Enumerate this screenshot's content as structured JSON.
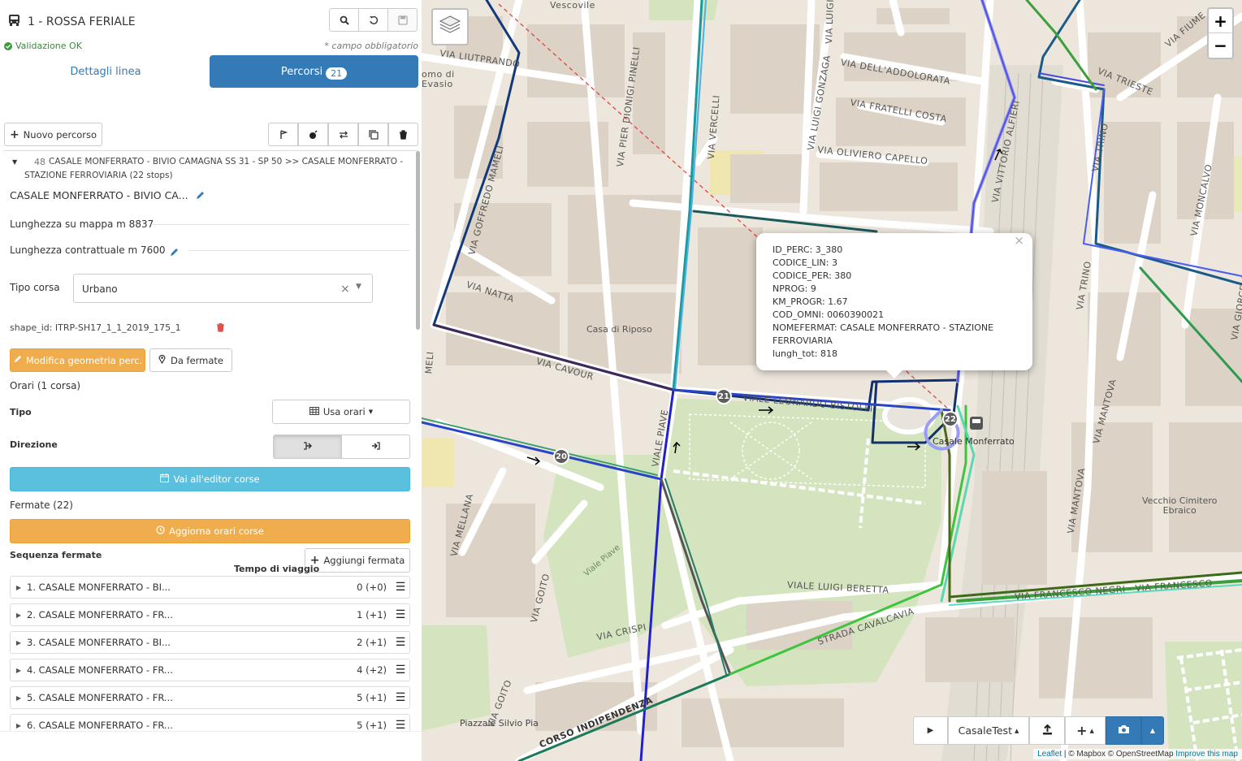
{
  "header": {
    "line_title": "1 - ROSSA FERIALE",
    "validation": "Validazione OK",
    "required_note": "* campo obbligatorio"
  },
  "tabs": {
    "details": "Dettagli linea",
    "routes": "Percorsi",
    "routes_count": "21"
  },
  "toolbar": {
    "new_route": "Nuovo percorso"
  },
  "route": {
    "id": "48",
    "description_line1": "CASALE MONFERRATO - BIVIO CAMAGNA SS 31 - SP 50 >> CASALE MONFERRATO -",
    "description_line2": "STAZIONE FERROVIARIA (22 stops)",
    "name": "CASALE MONFERRATO - BIVIO CA...",
    "map_length": "Lunghezza su mappa m 8837",
    "contract_length": "Lunghezza contrattuale m 7600",
    "trip_type_label": "Tipo corsa",
    "trip_type_value": "Urbano",
    "shape_id": "shape_id: ITRP-SH17_1_1_2019_175_1",
    "edit_geometry": "Modifica geometria perc.",
    "from_stops": "Da fermate",
    "schedules": "Orari (1 corsa)",
    "type_label": "Tipo",
    "use_schedules": "Usa orari",
    "direction_label": "Direzione",
    "editor_button": "Vai all'editor corse",
    "stops_header": "Fermate (22)",
    "update_button": "Aggiorna orari corse",
    "sequence_label": "Sequenza fermate",
    "add_stop": "Aggiungi fermata",
    "travel_time": "Tempo di viaggio"
  },
  "stops": [
    {
      "name": "1. CASALE MONFERRATO - BI...",
      "time": "0 (+0)"
    },
    {
      "name": "2. CASALE MONFERRATO - FR...",
      "time": "1 (+1)"
    },
    {
      "name": "3. CASALE MONFERRATO - BI...",
      "time": "2 (+1)"
    },
    {
      "name": "4. CASALE MONFERRATO - FR...",
      "time": "4 (+2)"
    },
    {
      "name": "5. CASALE MONFERRATO - FR...",
      "time": "5 (+1)"
    },
    {
      "name": "6. CASALE MONFERRATO - FR...",
      "time": "5 (+1)"
    }
  ],
  "popup": {
    "lines": [
      "ID_PERC: 3_380",
      "CODICE_LIN: 3",
      "CODICE_PER: 380",
      "NPROG: 9",
      "KM_PROGR: 1.67",
      "COD_OMNI: 0060390021",
      "NOMEFERMAT: CASALE MONFERRATO - STAZIONE",
      "FERROVIARIA",
      "lungh_tot: 818"
    ]
  },
  "map": {
    "zoom_in": "+",
    "zoom_out": "−",
    "layer_name": "CasaleTest",
    "attribution_leaflet": "Leaflet",
    "attribution_rest": " | © Mapbox © OpenStreetMap ",
    "attribution_improve": "Improve this map",
    "markers": [
      "21",
      "20",
      "22"
    ],
    "labels": {
      "vescovile": "Vescovile",
      "liutprando": "VIA LIUTPRANDO",
      "evasio": "omo di\nEvasio",
      "pinelli": "VIA PIER DIONIGI PINELLI",
      "vercelli": "VIA VERCELLI",
      "luigi": "VIA LUIGI",
      "gonzaga": "VIA LUIGI GONZAGA",
      "addolorata": "VIA DELL'ADDOLORATA",
      "fratelli": "VIA FRATELLI COSTA",
      "capello": "VIA OLIVIERO CAPELLO",
      "alfieri": "VIA VITTORIO ALFIERI",
      "trieste": "VIA TRIESTE",
      "fiume": "VIA FIUME",
      "trino": "VIA TRINO",
      "trino2": "VIA TRINO",
      "moncalvo": "VIA MONCALVO",
      "giorcelli": "VIA GIORCELLI",
      "mameli": "VIA GOFFREDO MAMELI",
      "natta": "VIA NATTA",
      "riposo": "Casa di Riposo",
      "cavour": "VIA CAVOUR",
      "bistolfi": "VIALE LEONARDO BISTOLFI",
      "piave": "VIALE PIAVE",
      "casale": "Casale Monferrato",
      "mellana": "VIA MELLANA",
      "goito": "VIA GOITO",
      "goito2": "VIA GOITO",
      "viale_piave_park": "Viale Piave",
      "beretta": "VIALE LUIGI BERETTA",
      "crispi": "VIA CRISPI",
      "cavalcavia": "STRADA CAVALCAVIA",
      "mantova": "VIA MANTOVA",
      "mantova2": "VIA MANTOVA",
      "cimitero": "Vecchio Cimitero\nEbraico",
      "negri": "VIA FRANCESCO NEGRI · VIA FRANCESCO",
      "indipendenza": "CORSO INDIPENDENZA",
      "silvio": "Piazzale Silvio Pia",
      "eli": "MELI"
    }
  },
  "colors": {
    "primary": "#337ab7",
    "warning": "#f0ad4e",
    "info": "#5bc0de",
    "success": "#3c9a3c",
    "danger": "#d9534f"
  }
}
